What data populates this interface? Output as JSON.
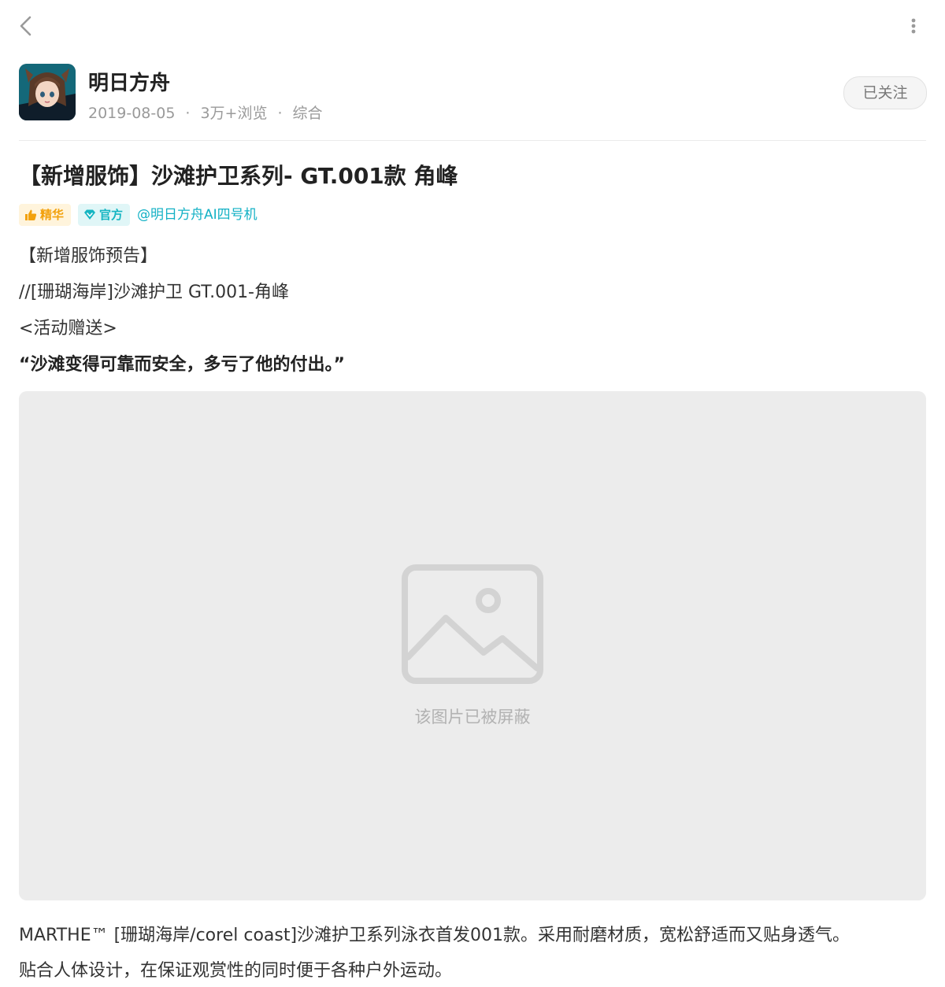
{
  "nav": {
    "back_icon": "chevron-left-icon",
    "more_icon": "vertical-ellipsis-icon"
  },
  "author": {
    "name": "明日方舟",
    "date": "2019-08-05",
    "views": "3万+浏览",
    "category": "综合",
    "separator": "·",
    "follow_label": "已关注"
  },
  "post": {
    "title": "【新增服饰】沙滩护卫系列- GT.001款 角峰",
    "tags": {
      "essence": "精华",
      "official": "官方"
    },
    "mention": "@明日方舟AI四号机",
    "lines": [
      "【新增服饰预告】",
      "//[珊瑚海岸]沙滩护卫 GT.001-角峰",
      "<活动赠送>",
      "“沙滩变得可靠而安全，多亏了他的付出。”"
    ],
    "image_placeholder": "该图片已被屏蔽",
    "description": [
      "MARTHE™ [珊瑚海岸/corel coast]沙滩护卫系列泳衣首发001款。采用耐磨材质，宽松舒适而又贴身透气。",
      "贴合人体设计，在保证观赏性的同时便于各种户外运动。"
    ]
  },
  "colors": {
    "essence": "#f2a10c",
    "official": "#15b5c2",
    "mention": "#13b1c5",
    "meta": "#9a9a9a"
  }
}
